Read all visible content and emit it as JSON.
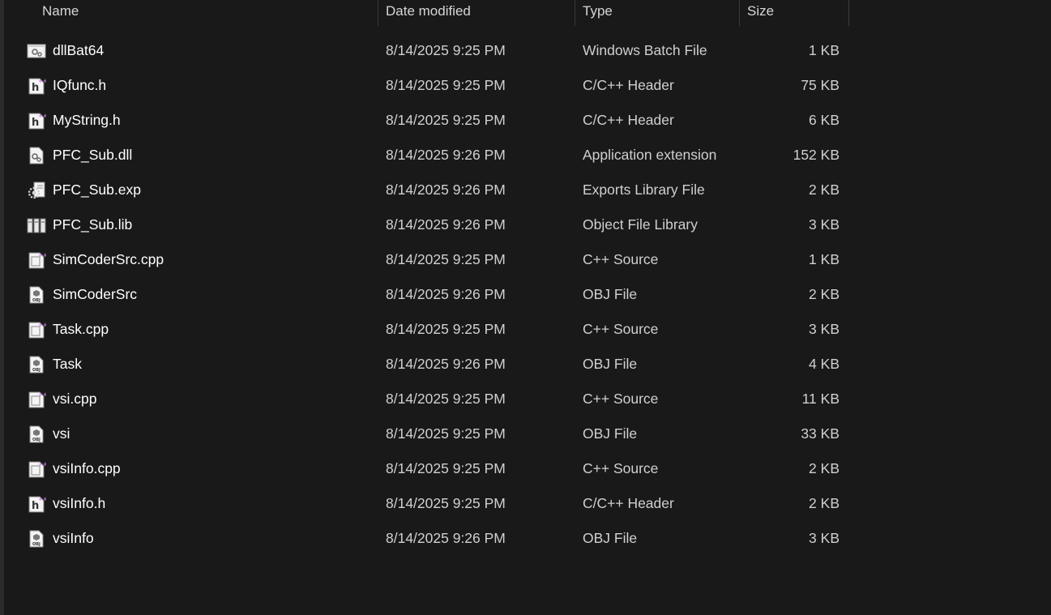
{
  "columns": {
    "name": "Name",
    "date": "Date modified",
    "type": "Type",
    "size": "Size"
  },
  "files": [
    {
      "name": "dllBat64",
      "date": "8/14/2025 9:25 PM",
      "type": "Windows Batch File",
      "size": "1 KB",
      "icon": "batch-file-icon"
    },
    {
      "name": "IQfunc.h",
      "date": "8/14/2025 9:25 PM",
      "type": "C/C++ Header",
      "size": "75 KB",
      "icon": "header-file-icon"
    },
    {
      "name": "MyString.h",
      "date": "8/14/2025 9:25 PM",
      "type": "C/C++ Header",
      "size": "6 KB",
      "icon": "header-file-icon"
    },
    {
      "name": "PFC_Sub.dll",
      "date": "8/14/2025 9:26 PM",
      "type": "Application extension",
      "size": "152 KB",
      "icon": "dll-file-icon"
    },
    {
      "name": "PFC_Sub.exp",
      "date": "8/14/2025 9:26 PM",
      "type": "Exports Library File",
      "size": "2 KB",
      "icon": "exports-file-icon"
    },
    {
      "name": "PFC_Sub.lib",
      "date": "8/14/2025 9:26 PM",
      "type": "Object File Library",
      "size": "3 KB",
      "icon": "library-file-icon"
    },
    {
      "name": "SimCoderSrc.cpp",
      "date": "8/14/2025 9:25 PM",
      "type": "C++ Source",
      "size": "1 KB",
      "icon": "cpp-source-icon"
    },
    {
      "name": "SimCoderSrc",
      "date": "8/14/2025 9:26 PM",
      "type": "OBJ File",
      "size": "2 KB",
      "icon": "obj-file-icon"
    },
    {
      "name": "Task.cpp",
      "date": "8/14/2025 9:25 PM",
      "type": "C++ Source",
      "size": "3 KB",
      "icon": "cpp-source-icon"
    },
    {
      "name": "Task",
      "date": "8/14/2025 9:26 PM",
      "type": "OBJ File",
      "size": "4 KB",
      "icon": "obj-file-icon"
    },
    {
      "name": "vsi.cpp",
      "date": "8/14/2025 9:25 PM",
      "type": "C++ Source",
      "size": "11 KB",
      "icon": "cpp-source-icon"
    },
    {
      "name": "vsi",
      "date": "8/14/2025 9:25 PM",
      "type": "OBJ File",
      "size": "33 KB",
      "icon": "obj-file-icon"
    },
    {
      "name": "vsiInfo.cpp",
      "date": "8/14/2025 9:25 PM",
      "type": "C++ Source",
      "size": "2 KB",
      "icon": "cpp-source-icon"
    },
    {
      "name": "vsiInfo.h",
      "date": "8/14/2025 9:25 PM",
      "type": "C/C++ Header",
      "size": "2 KB",
      "icon": "header-file-icon"
    },
    {
      "name": "vsiInfo",
      "date": "8/14/2025 9:26 PM",
      "type": "OBJ File",
      "size": "3 KB",
      "icon": "obj-file-icon"
    }
  ],
  "colors": {
    "background": "#191919",
    "text": "#ffffff",
    "subtext": "#d0d0d0",
    "divider": "#3a3a3a",
    "cpp_accent": "#c880e6"
  }
}
